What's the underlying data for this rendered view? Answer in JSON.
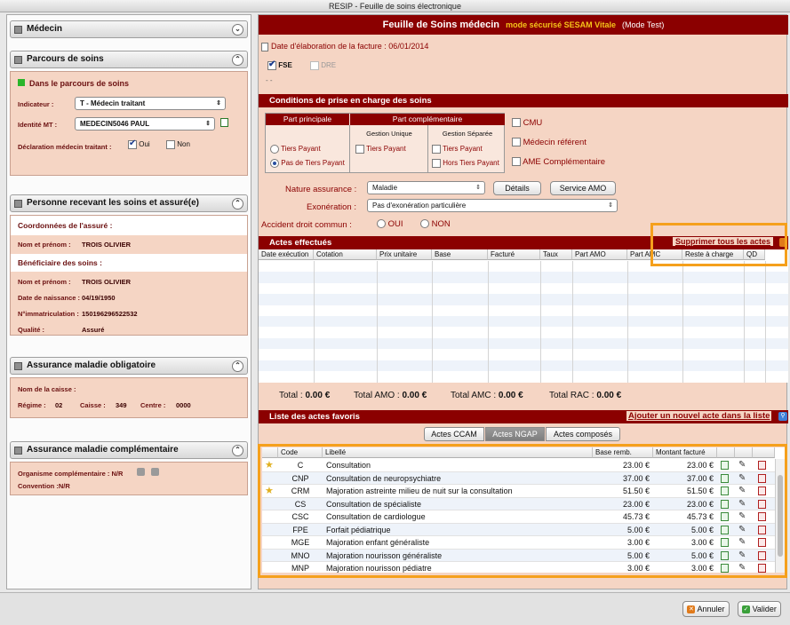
{
  "window": {
    "title": "RESIP - Feuille de soins électronique"
  },
  "left": {
    "medecin": {
      "title": "Médecin"
    },
    "parcours": {
      "title": "Parcours de soins",
      "status": "Dans le parcours de soins",
      "indicateur_label": "Indicateur :",
      "indicateur_value": "T - Médecin traitant",
      "identite_label": "Identité MT :",
      "identite_value": "MEDECIN5046 PAUL",
      "declaration_label": "Déclaration médecin traitant :",
      "oui": "Oui",
      "non": "Non"
    },
    "personne": {
      "title": "Personne recevant les soins et assuré(e)",
      "coord_title": "Coordonnées de l'assuré :",
      "nom_label": "Nom et prénom :",
      "nom_value": "TROIS OLIVIER",
      "benef_title": "Bénéficiaire des soins :",
      "nom2_label": "Nom et prénom :",
      "nom2_value": "TROIS OLIVIER",
      "naissance_label": "Date de naissance :",
      "naissance_value": "04/19/1950",
      "immat_label": "N°immatriculation :",
      "immat_value": "150196296522532",
      "qualite_label": "Qualité :",
      "qualite_value": "Assuré"
    },
    "amo": {
      "title": "Assurance maladie obligatoire",
      "caisse_label": "Nom de la caisse :",
      "regime_label": "Régime :",
      "regime_value": "02",
      "caisse2_label": "Caisse :",
      "caisse2_value": "349",
      "centre_label": "Centre :",
      "centre_value": "0000"
    },
    "amc": {
      "title": "Assurance maladie complémentaire",
      "org_label": "Organisme complémentaire : N/R",
      "conv_label": "Convention :N/R"
    }
  },
  "right": {
    "header": {
      "title": "Feuille de Soins médecin",
      "mode": "mode sécurisé SESAM Vitale",
      "test": "(Mode Test)"
    },
    "date_label": "Date d'élaboration de la facture : 06/01/2014",
    "fse": "FSE",
    "dre": "DRE",
    "dashes": "- -",
    "conditions": {
      "title": "Conditions de prise en charge des soins",
      "part_principale": "Part principale",
      "part_complementaire": "Part complémentaire",
      "gestion_unique": "Gestion Unique",
      "gestion_separee": "Gestion Séparée",
      "tiers_payant": "Tiers Payant",
      "pas_tiers_payant": "Pas de Tiers Payant",
      "tiers_payant_gu": "Tiers Payant",
      "tiers_payant_gs": "Tiers Payant",
      "hors_tiers_payant": "Hors Tiers Payant",
      "cmu": "CMU",
      "medecin_referent": "Médecin référent",
      "ame": "AME Complémentaire",
      "nature_label": "Nature assurance :",
      "nature_value": "Maladie",
      "details_button": "Détails",
      "service_amo_button": "Service AMO",
      "exoneration_label": "Exonération :",
      "exoneration_value": "Pas d'exonération particulière",
      "accident_label": "Accident droit commun :",
      "oui": "OUI",
      "non": "NON"
    },
    "actes": {
      "title": "Actes effectués",
      "supprimer": "Supprimer tous les actes",
      "columns": [
        "Date exécution",
        "Cotation",
        "Prix unitaire",
        "Base",
        "Facturé",
        "Taux",
        "Part AMO",
        "Part AMC",
        "Reste à charge",
        "QD"
      ],
      "total": "Total : ",
      "total_value": "0.00 €",
      "total_amo": "Total AMO : ",
      "total_amo_value": "0.00 €",
      "total_amc": "Total AMC : ",
      "total_amc_value": "0.00 €",
      "total_rac": "Total RAC : ",
      "total_rac_value": "0.00 €"
    },
    "favoris": {
      "title": "Liste des actes favoris",
      "ajouter": "Ajouter un nouvel acte dans la liste",
      "tabs": [
        "Actes CCAM",
        "Actes NGAP",
        "Actes composés"
      ],
      "columns": [
        "Code",
        "Libellé",
        "Base remb.",
        "Montant facturé"
      ],
      "rows": [
        {
          "star": true,
          "code": "C",
          "libelle": "Consultation",
          "base": "23.00 €",
          "montant": "23.00 €"
        },
        {
          "star": false,
          "code": "CNP",
          "libelle": "Consultation de neuropsychiatre",
          "base": "37.00 €",
          "montant": "37.00 €"
        },
        {
          "star": true,
          "code": "CRM",
          "libelle": "Majoration astreinte milieu de nuit sur la consultation",
          "base": "51.50 €",
          "montant": "51.50 €"
        },
        {
          "star": false,
          "code": "CS",
          "libelle": "Consultation de spécialiste",
          "base": "23.00 €",
          "montant": "23.00 €"
        },
        {
          "star": false,
          "code": "CSC",
          "libelle": "Consultation de cardiologue",
          "base": "45.73 €",
          "montant": "45.73 €"
        },
        {
          "star": false,
          "code": "FPE",
          "libelle": "Forfait pédiatrique",
          "base": "5.00 €",
          "montant": "5.00 €"
        },
        {
          "star": false,
          "code": "MGE",
          "libelle": "Majoration enfant généraliste",
          "base": "3.00 €",
          "montant": "3.00 €"
        },
        {
          "star": false,
          "code": "MNO",
          "libelle": "Majoration nourisson généraliste",
          "base": "5.00 €",
          "montant": "5.00 €"
        },
        {
          "star": false,
          "code": "MNP",
          "libelle": "Majoration nourisson pédiatre",
          "base": "3.00 €",
          "montant": "3.00 €"
        }
      ]
    }
  },
  "footer": {
    "annuler": "Annuler",
    "valider": "Valider"
  },
  "colors": {
    "accent": "#8b0000",
    "panel": "#f5d5c4",
    "highlight": "#f5a01c",
    "link": "#8b0000"
  }
}
